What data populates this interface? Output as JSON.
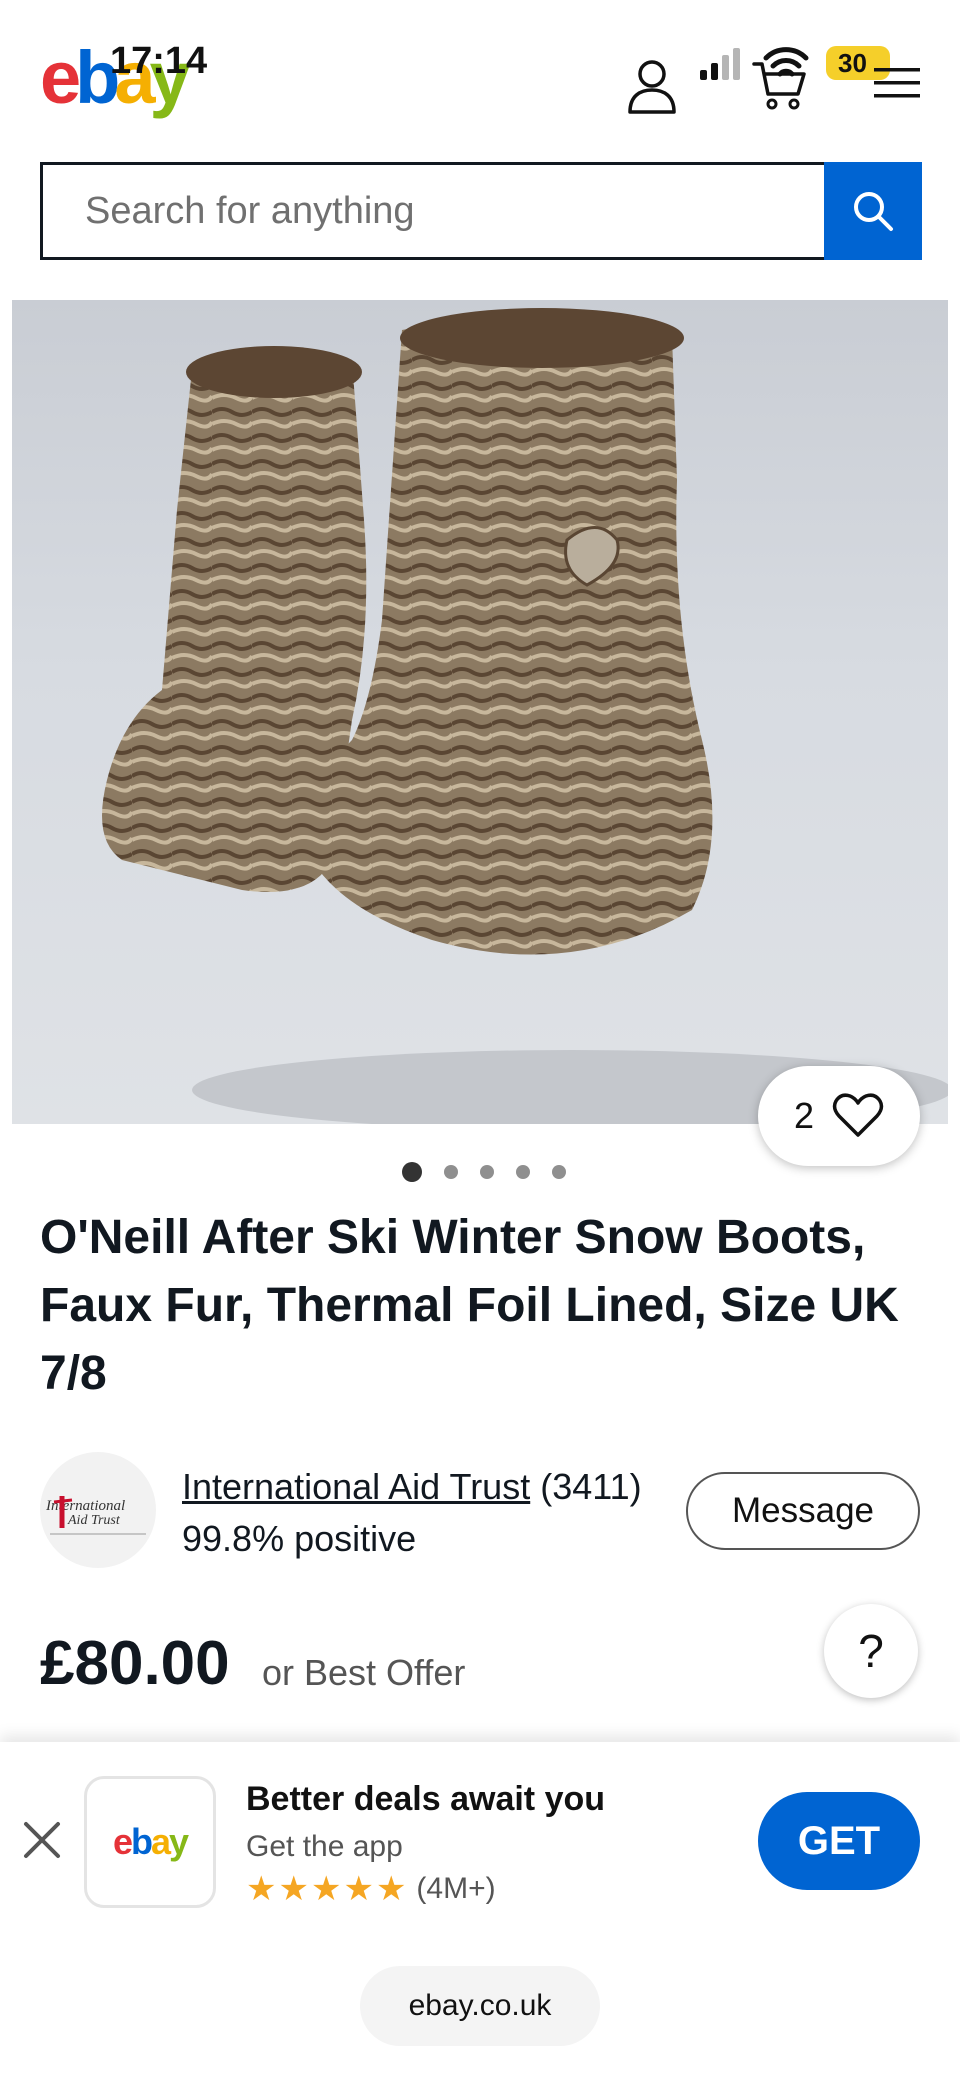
{
  "status_bar": {
    "time": "17:14",
    "battery": "30"
  },
  "header": {
    "logo_letters": [
      "e",
      "b",
      "a",
      "y"
    ],
    "icons": [
      "user-icon",
      "signal-icon",
      "wifi-icon",
      "cart-icon",
      "battery-icon",
      "menu-icon"
    ]
  },
  "search": {
    "placeholder": "Search for anything",
    "button_icon": "search-icon"
  },
  "listing": {
    "watch_count": "2",
    "image_count_dots": 5,
    "active_image_index": 0,
    "title": "O'Neill After Ski Winter Snow Boots, Faux Fur, Thermal Foil Lined, Size UK 7/8"
  },
  "seller": {
    "name": "International Aid Trust",
    "feedback_count": "(3411)",
    "positive": "99.8% positive",
    "logo_text_line1": "International",
    "logo_text_line2": "Aid Trust",
    "message_label": "Message"
  },
  "price": {
    "amount": "£80.00",
    "offer": "or Best Offer",
    "help": "?"
  },
  "app_banner": {
    "logo": "ebay",
    "title": "Better deals await you",
    "subtitle": "Get the app",
    "stars": 5,
    "rating_count": "(4M+)",
    "get_label": "GET"
  },
  "browser": {
    "url": "ebay.co.uk"
  },
  "colors": {
    "ebay_red": "#e53238",
    "ebay_blue": "#0064d2",
    "ebay_yellow": "#f5af02",
    "ebay_green": "#86b817",
    "star": "#f5a623"
  }
}
